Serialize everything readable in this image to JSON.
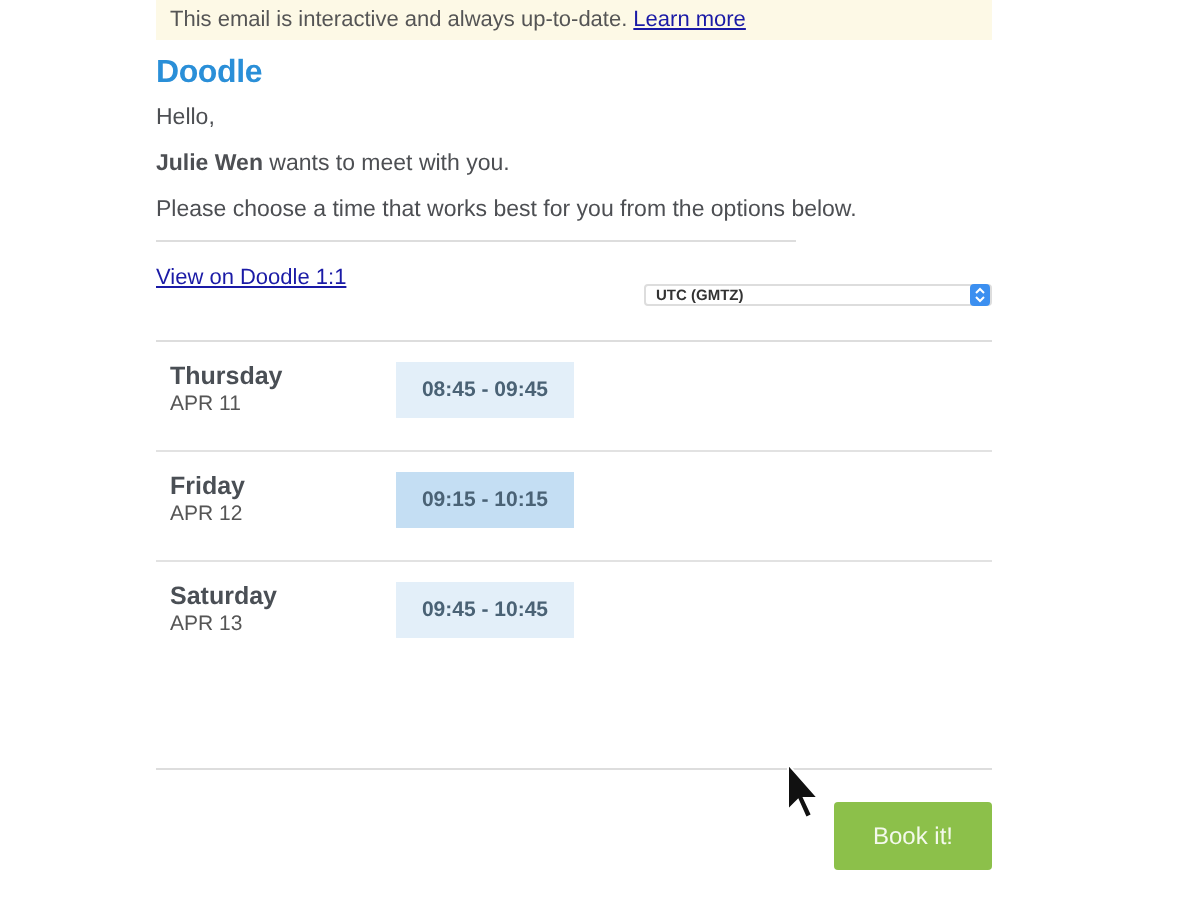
{
  "banner": {
    "text": "This email is interactive and always up-to-date.",
    "link": "Learn more"
  },
  "logo": "Doodle",
  "greeting": "Hello,",
  "invite": "**Julie Wen** wants to meet with you.",
  "instruction": "Please choose a time that works best for you from the options below.",
  "view_link": "View on Doodle 1:1",
  "timezone": {
    "value": "UTC (GMTZ)"
  },
  "days": [
    {
      "day": "Thursday",
      "date": "APR 11",
      "slot": "08:45 - 09:45",
      "selected": false
    },
    {
      "day": "Friday",
      "date": "APR 12",
      "slot": "09:15 - 10:15",
      "selected": true
    },
    {
      "day": "Saturday",
      "date": "APR 13",
      "slot": "09:45 - 10:45",
      "selected": false
    }
  ],
  "book_button": "Book it!"
}
